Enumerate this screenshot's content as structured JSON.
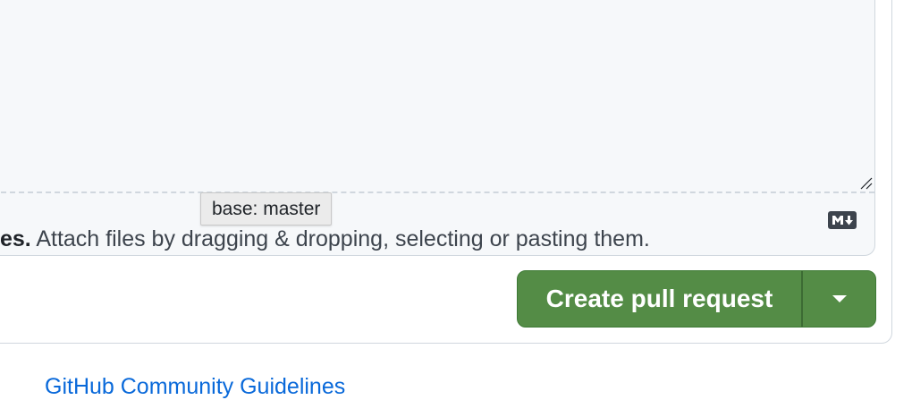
{
  "comment": {
    "attach_strong": "es.",
    "attach_text": " Attach files by dragging & dropping, selecting or pasting them.",
    "markdown_icon": "markdown-icon"
  },
  "tooltip": {
    "text": "base: master"
  },
  "actions": {
    "create_label": "Create pull request",
    "dropdown_icon": "caret-down-icon"
  },
  "footer": {
    "link_text": "GitHub Community Guidelines"
  },
  "colors": {
    "button_green": "#548c46",
    "link_blue": "#0969da",
    "border": "#d0d7de",
    "textarea_bg": "#f6f8fa"
  }
}
